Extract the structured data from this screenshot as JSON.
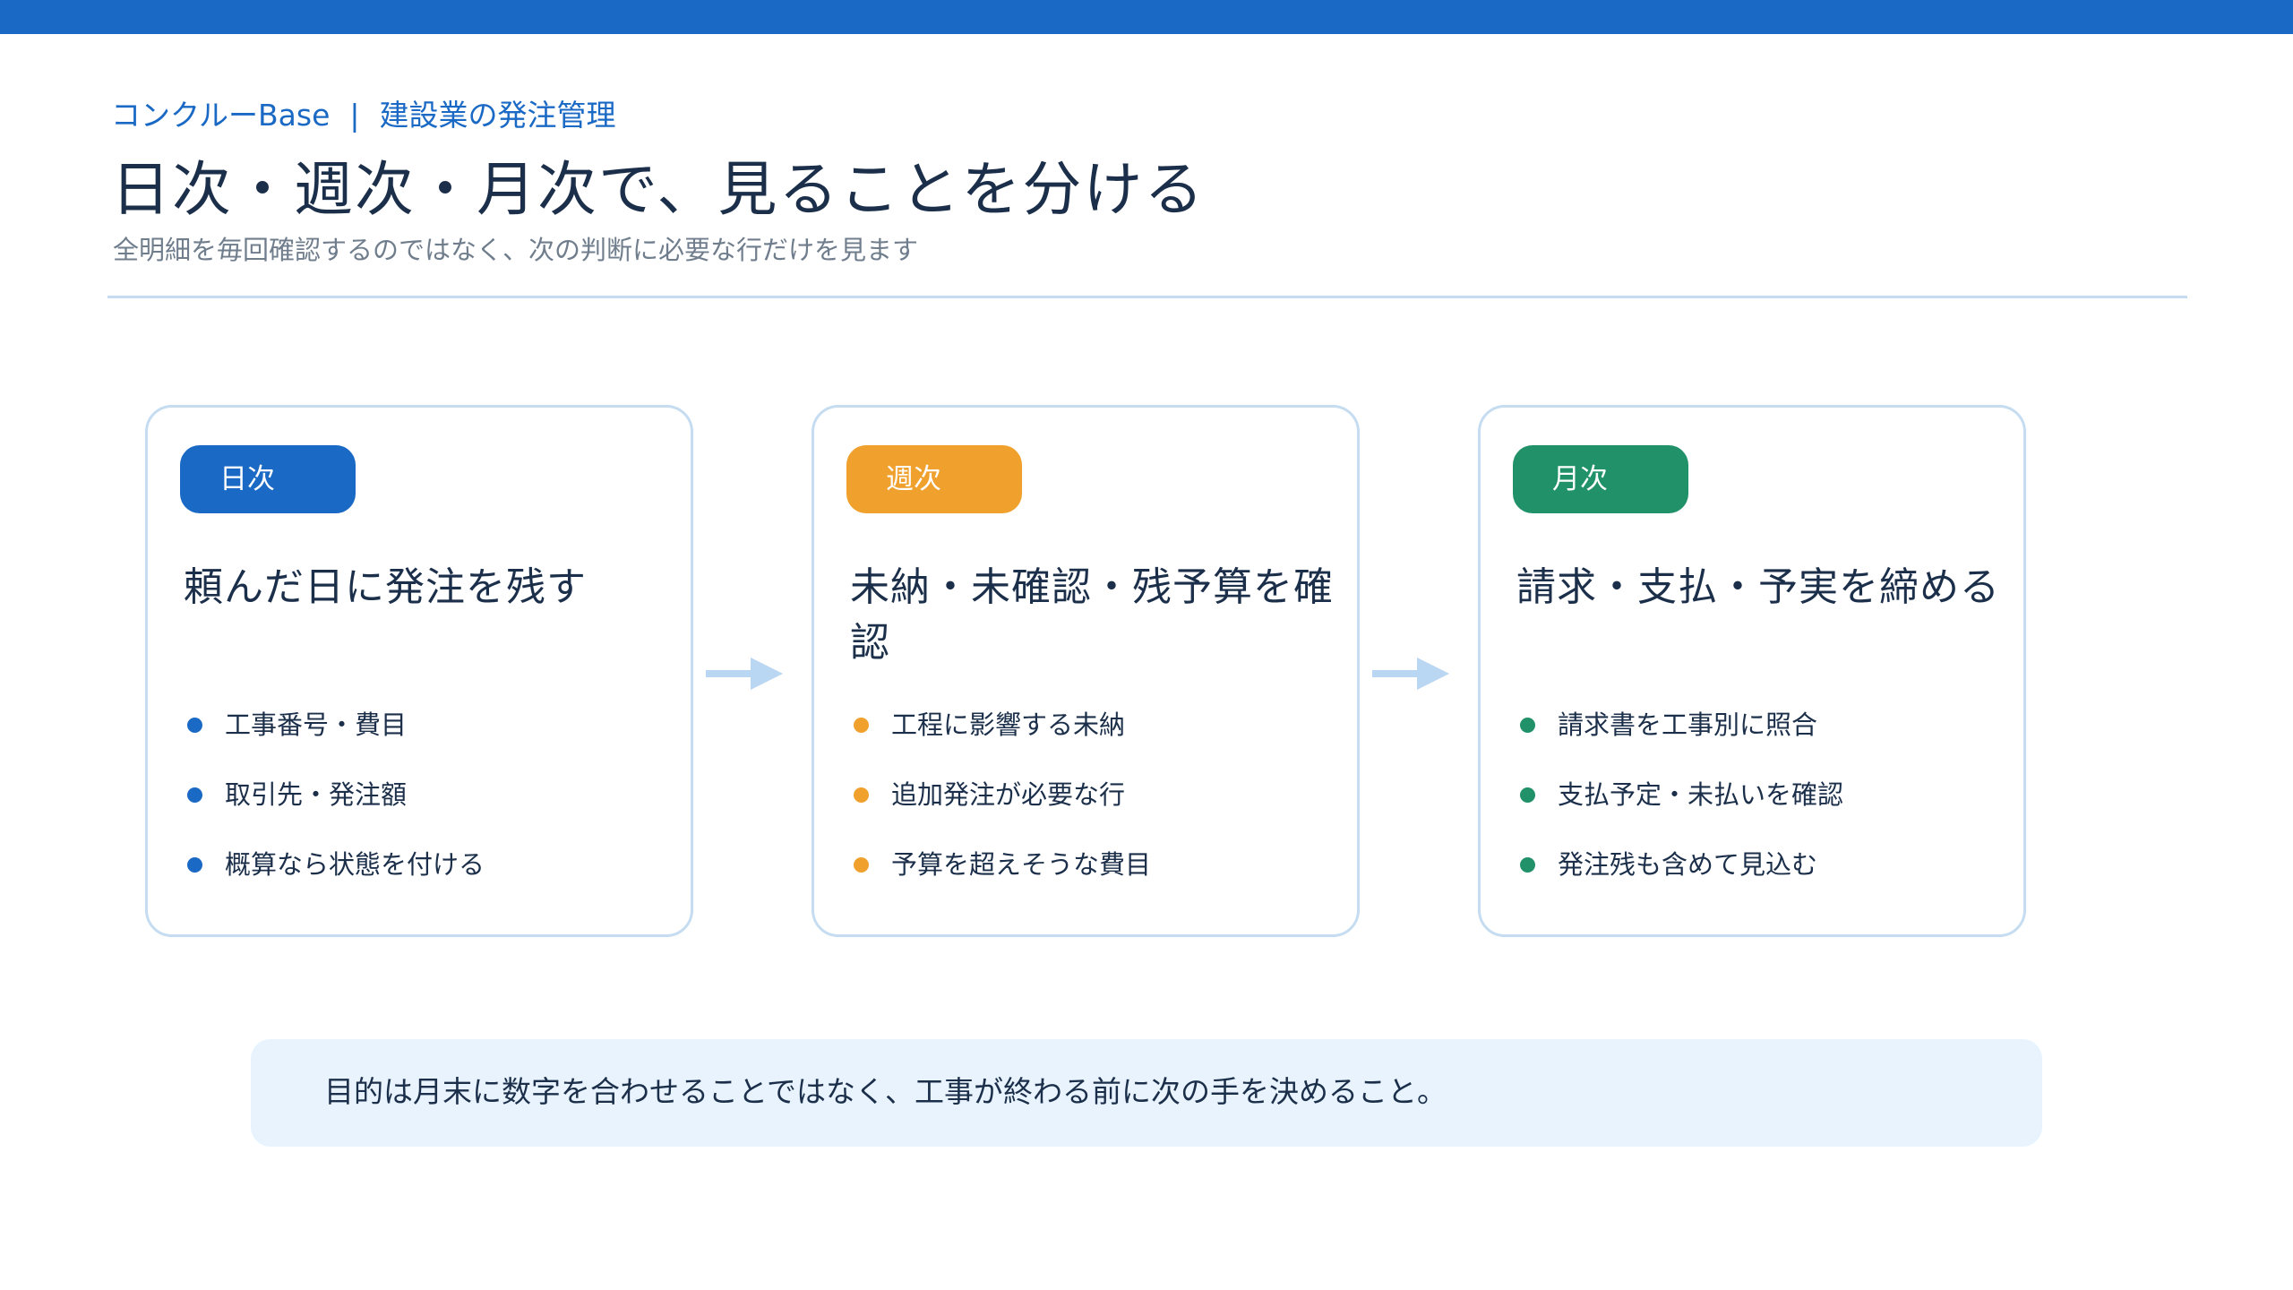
{
  "header": {
    "brand": "コンクルーBase",
    "separator": "|",
    "section": "建設業の発注管理",
    "title": "日次・週次・月次で、見ることを分ける",
    "subtitle": "全明細を毎回確認するのではなく、次の判断に必要な行だけを見ます"
  },
  "colors": {
    "accent": "#1a69c4",
    "daily": "#1a69c4",
    "weekly": "#f0a12d",
    "monthly": "#209169",
    "card_border": "#c5dcf1",
    "arrow": "#b9d6f2",
    "note_bg": "#e8f3fd"
  },
  "cards": [
    {
      "tag": "日次",
      "title": "頼んだ日に発注を残す",
      "items": [
        "工事番号・費目",
        "取引先・発注額",
        "概算なら状態を付ける"
      ]
    },
    {
      "tag": "週次",
      "title": "未納・未確認・残予算を確認",
      "items": [
        "工程に影響する未納",
        "追加発注が必要な行",
        "予算を超えそうな費目"
      ]
    },
    {
      "tag": "月次",
      "title": "請求・支払・予実を締める",
      "items": [
        "請求書を工事別に照合",
        "支払予定・未払いを確認",
        "発注残も含めて見込む"
      ]
    }
  ],
  "arrows": [
    "arrow-right-icon",
    "arrow-right-icon"
  ],
  "note": "目的は月末に数字を合わせることではなく、工事が終わる前に次の手を決めること。"
}
